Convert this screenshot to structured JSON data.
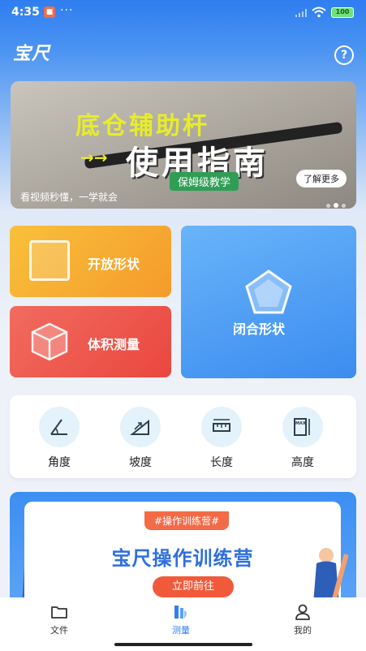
{
  "status_bar": {
    "time": "4:35",
    "battery": "100"
  },
  "header": {
    "logo": "宝尺",
    "help_icon": "?"
  },
  "banner": {
    "title_1": "底仓辅助杆",
    "title_2": "使用指南",
    "arrows": "→→",
    "tag": "保姆级教学",
    "more_button": "了解更多",
    "caption": "看视频秒懂，一学就会",
    "active_dot_index": 1,
    "dot_count": 3
  },
  "features": {
    "open_shape": "开放形状",
    "volume": "体积测量",
    "closed_shape": "闭合形状"
  },
  "tools": [
    {
      "label": "角度",
      "icon": "angle-icon"
    },
    {
      "label": "坡度",
      "icon": "slope-icon"
    },
    {
      "label": "长度",
      "icon": "ruler-icon"
    },
    {
      "label": "高度",
      "icon": "height-icon"
    }
  ],
  "camp": {
    "tag": "#操作训练营#",
    "title": "宝尺操作训练营",
    "button": "立即前往"
  },
  "nav": [
    {
      "label": "文件",
      "icon": "folder-icon",
      "active": false
    },
    {
      "label": "测量",
      "icon": "measure-icon",
      "active": true
    },
    {
      "label": "我的",
      "icon": "user-icon",
      "active": false
    }
  ],
  "colors": {
    "primary": "#2f7ef0",
    "open_card": "#f6a830",
    "volume_card": "#ec5248",
    "closed_card": "#4f9ff5",
    "camp_button": "#f05a3a"
  }
}
